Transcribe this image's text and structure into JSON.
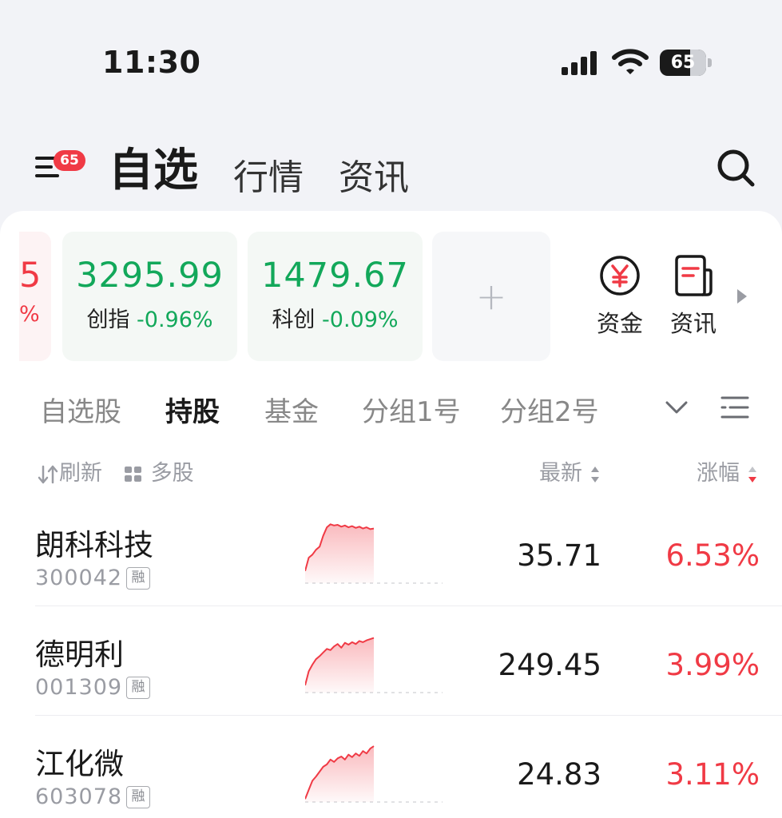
{
  "status": {
    "time": "11:30",
    "battery_level": "65",
    "battery_fraction": 0.65
  },
  "header": {
    "menu_badge": "65",
    "tabs": [
      {
        "label": "自选",
        "active": true
      },
      {
        "label": "行情",
        "active": false
      },
      {
        "label": "资讯",
        "active": false
      }
    ]
  },
  "index_cards": {
    "partial": {
      "value_fragment": "5",
      "change_fragment": "%",
      "color": "#f03a45"
    },
    "items": [
      {
        "value": "3295.99",
        "name": "创指",
        "change": "-0.96%"
      },
      {
        "value": "1479.67",
        "name": "科创",
        "change": "-0.09%"
      }
    ],
    "add_label": "+",
    "up_color": "#f03a45",
    "down_color": "#12a85a"
  },
  "shortcuts": [
    {
      "label": "资金",
      "icon": "yuan-circle-icon"
    },
    {
      "label": "资讯",
      "icon": "news-document-icon"
    }
  ],
  "sub_tabs": [
    {
      "label": "自选股",
      "active": false
    },
    {
      "label": "持股",
      "active": true
    },
    {
      "label": "基金",
      "active": false
    },
    {
      "label": "分组1号",
      "active": false
    },
    {
      "label": "分组2号",
      "active": false
    }
  ],
  "list_header": {
    "refresh_label": "刷新",
    "multi_label": "多股",
    "latest_label": "最新",
    "change_label": "涨幅"
  },
  "stocks": [
    {
      "name": "朗科科技",
      "code": "300042",
      "tag": "融",
      "price": "35.71",
      "change": "6.53%",
      "spark": [
        0.2,
        0.42,
        0.47,
        0.55,
        0.6,
        0.78,
        0.92,
        0.97,
        0.95,
        0.96,
        0.93,
        0.95,
        0.92,
        0.94,
        0.91,
        0.93,
        0.9,
        0.92,
        0.89,
        0.9
      ]
    },
    {
      "name": "德明利",
      "code": "001309",
      "tag": "融",
      "price": "249.45",
      "change": "3.99%",
      "spark": [
        0.12,
        0.35,
        0.46,
        0.55,
        0.6,
        0.66,
        0.72,
        0.7,
        0.76,
        0.8,
        0.74,
        0.82,
        0.79,
        0.83,
        0.8,
        0.85,
        0.83,
        0.86,
        0.88,
        0.9
      ]
    },
    {
      "name": "江化微",
      "code": "603078",
      "tag": "融",
      "price": "24.83",
      "change": "3.11%",
      "spark": [
        0.05,
        0.2,
        0.35,
        0.42,
        0.5,
        0.58,
        0.62,
        0.7,
        0.66,
        0.72,
        0.75,
        0.7,
        0.78,
        0.74,
        0.8,
        0.76,
        0.84,
        0.8,
        0.88,
        0.92
      ]
    }
  ]
}
